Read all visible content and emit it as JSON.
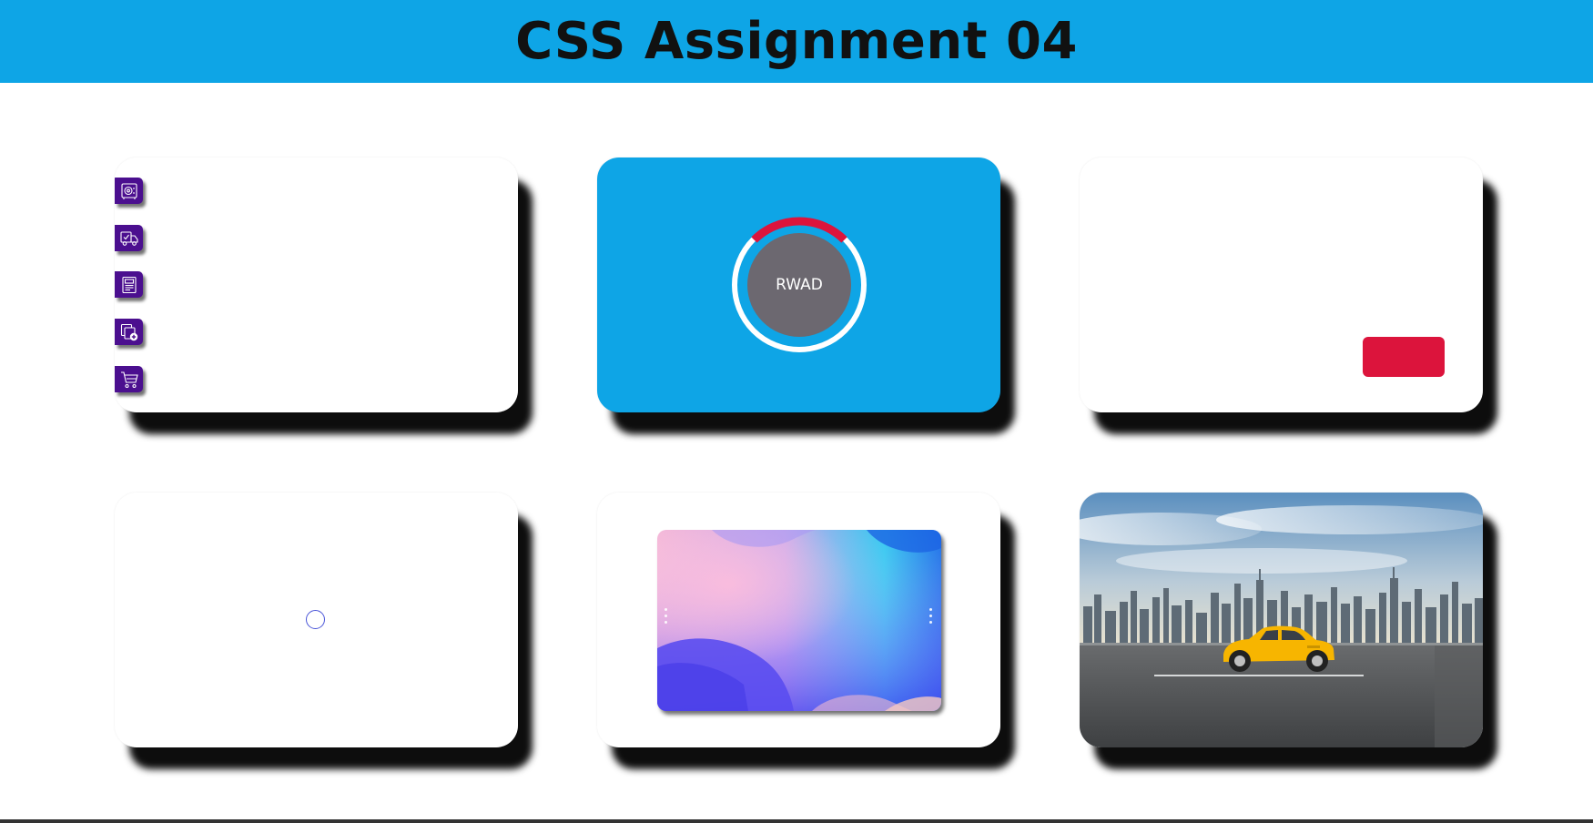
{
  "page": {
    "title": "CSS Assignment 04"
  },
  "colors": {
    "header_bg": "#0ea5e6",
    "icon_bg": "#4b0f8f",
    "ring_progress": "#dc143c",
    "ring_center": "#6c6870",
    "red_block": "#dc143c",
    "car": "#f7b500"
  },
  "cards": {
    "icon_menu": {
      "icons": [
        "safe-icon",
        "delivery-truck-icon",
        "document-icon",
        "add-copy-icon",
        "shopping-cart-icon"
      ]
    },
    "progress": {
      "label": "RWAD",
      "progress_fraction": 0.25
    },
    "button_card": {},
    "loader_card": {},
    "gradient_card": {},
    "scene_card": {}
  }
}
